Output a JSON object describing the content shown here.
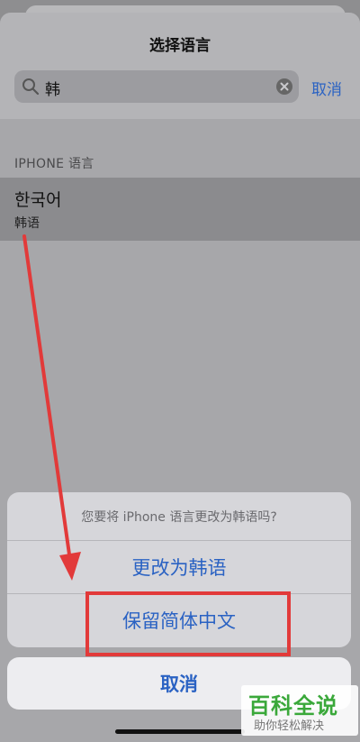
{
  "nav": {
    "title": "选择语言"
  },
  "search": {
    "value": "韩",
    "cancel_label": "取消"
  },
  "section": {
    "header": "IPHONE 语言"
  },
  "result": {
    "native": "한국어",
    "subtitle": "韩语"
  },
  "action_sheet": {
    "message": "您要将 iPhone 语言更改为韩语吗?",
    "change_label": "更改为韩语",
    "keep_label": "保留简体中文",
    "cancel_label": "取消"
  },
  "watermark": {
    "main": "百科全说",
    "sub": "助你轻松解决"
  },
  "colors": {
    "accent": "#2a62c3",
    "annotation": "#e23a3a",
    "watermark": "#3aa83a"
  },
  "icons": [
    "search-icon",
    "clear-icon"
  ]
}
